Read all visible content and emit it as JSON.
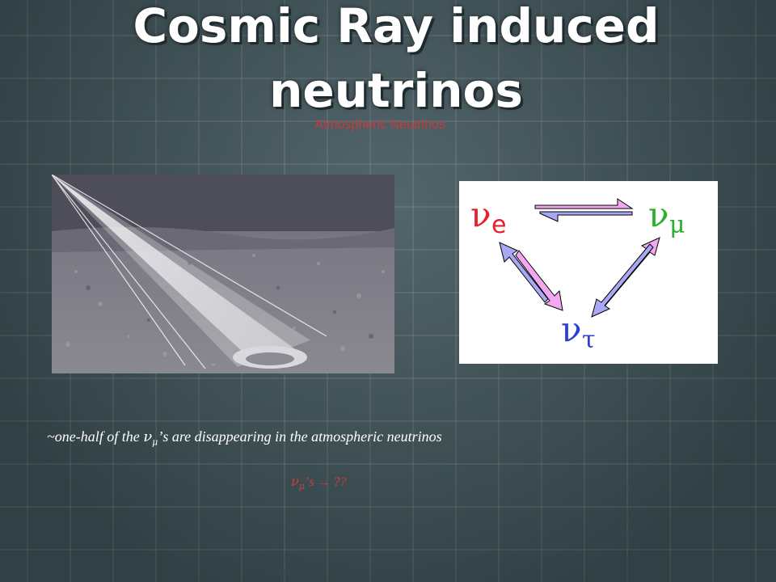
{
  "slide": {
    "title": "Cosmic Ray induced neutrinos",
    "subtitle": "Atmospheric Neutrinos",
    "caption": {
      "prefix": "~one-half of the ",
      "nu": "ν",
      "sub": "μ",
      "suffix": "’s are disappearing in the atmospheric neutrinos"
    },
    "question": {
      "nu": "ν",
      "sub": "μ",
      "suffix": "’s",
      "arrow": "→",
      "unknown": "??"
    }
  },
  "diagram": {
    "nodes": [
      {
        "nu": "ν",
        "sub": "e",
        "color": "#e8202a"
      },
      {
        "nu": "ν",
        "sub": "μ",
        "color": "#2db02d"
      },
      {
        "nu": "ν",
        "sub": "τ",
        "color": "#2a3fd6"
      }
    ],
    "arrow_colors": {
      "pink": "#f2a8f0",
      "blue": "#a8a8f5",
      "outline": "#000000"
    }
  },
  "colors": {
    "background": "#40555b",
    "title": "#ffffff",
    "subtitle": "#c93a3a",
    "caption": "#ffffff",
    "question": "#d83a3a"
  }
}
